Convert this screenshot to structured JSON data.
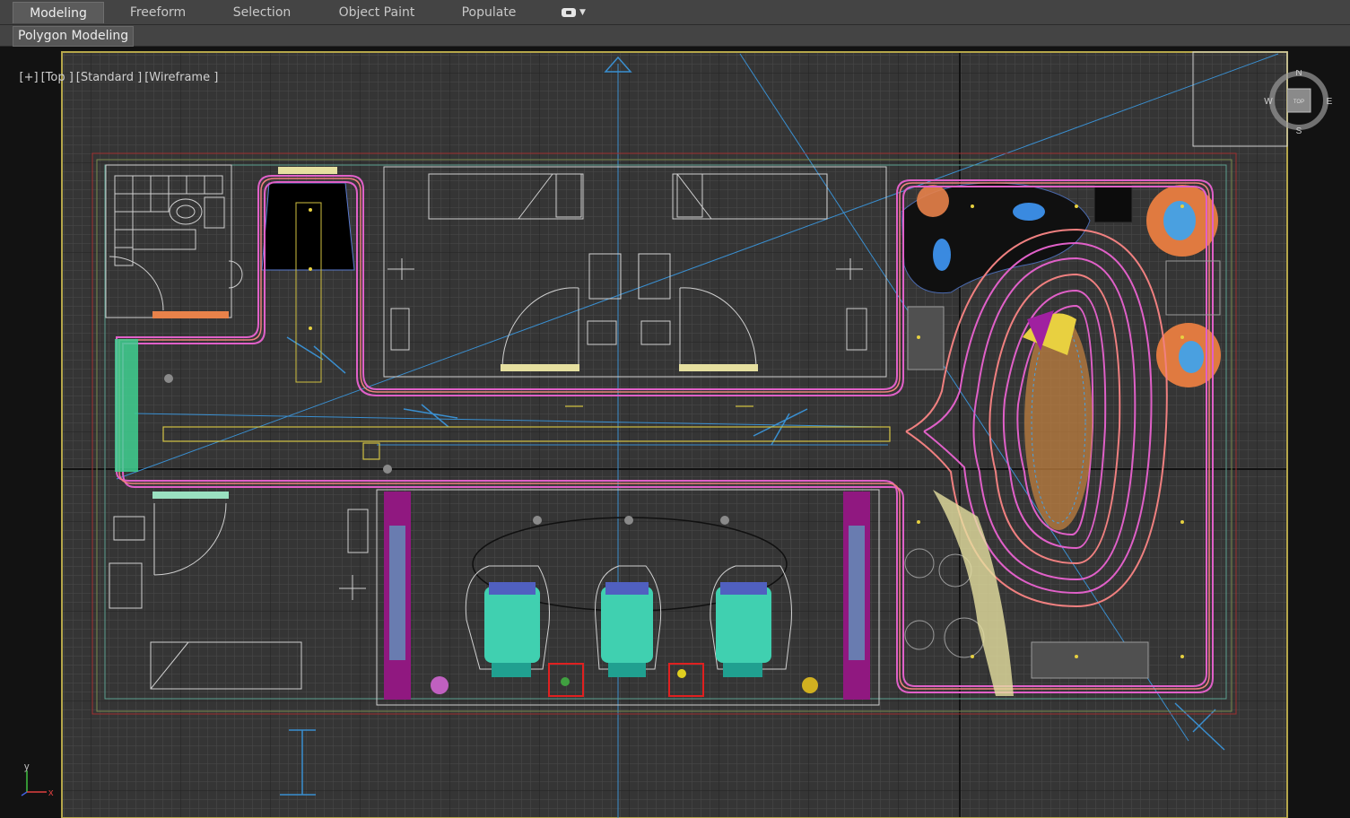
{
  "ribbon": {
    "tabs": [
      {
        "label": "Modeling",
        "active": true
      },
      {
        "label": "Freeform",
        "active": false
      },
      {
        "label": "Selection",
        "active": false
      },
      {
        "label": "Object Paint",
        "active": false
      },
      {
        "label": "Populate",
        "active": false
      }
    ],
    "toggle_icon": "ribbon-minimize-toggle-icon",
    "panel_button": "Polygon Modeling"
  },
  "viewport": {
    "label": {
      "plus": "[+]",
      "view": "[Top ]",
      "shading_style": "[Standard ]",
      "display_mode": "[Wireframe ]"
    },
    "viewcube": {
      "north": "N",
      "south": "S",
      "east": "E",
      "west": "W",
      "face": "TOP"
    },
    "axis_tripod": {
      "y": "y",
      "x": "x"
    },
    "colors": {
      "background": "#333333",
      "grid_minor": "#4a4a4a",
      "grid_major": "#121212",
      "active_border": "#b5a64a",
      "walls": "#d0d0d0",
      "magenta_path": "#e060c8",
      "pink_path": "#f08080",
      "orange_light": "#e8824a",
      "blue_light": "#4aa0e0",
      "chair": "#40d0b0"
    }
  }
}
